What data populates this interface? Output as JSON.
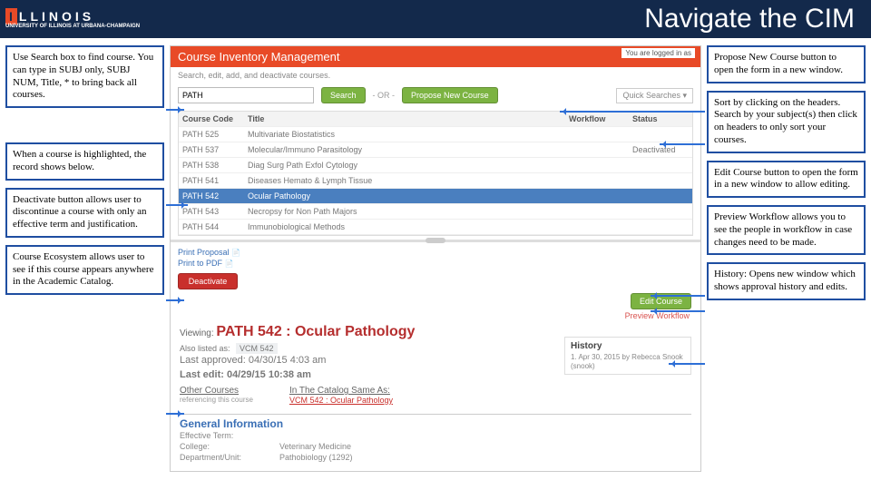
{
  "header": {
    "logo_letter": "I",
    "logo_rest": "LLINOIS",
    "logo_sub": "UNIVERSITY OF ILLINOIS AT URBANA-CHAMPAIGN",
    "title": "Navigate the CIM"
  },
  "left": {
    "c1": "Use Search box to find course. You can type in SUBJ only, SUBJ NUM, Title, * to bring back all courses.",
    "c2": "When a course is highlighted, the record shows below.",
    "c3": "Deactivate button allows user to discontinue a course with only an effective term and justification.",
    "c4": "Course Ecosystem allows user to see if this course appears anywhere in the Academic Catalog."
  },
  "right": {
    "c1": "Propose New Course button to open the form in a new window.",
    "c2": "Sort by clicking on the headers. Search by your subject(s) then click on headers to only sort your courses.",
    "c3": "Edit Course button to open the form in a new window to allow editing.",
    "c4": "Preview Workflow allows you to see the people in workflow in case changes need to be made.",
    "c5": "History: Opens new window which shows approval history and edits."
  },
  "app": {
    "title": "Course Inventory Management",
    "login": "You are logged in as",
    "subtitle": "Search, edit, add, and deactivate courses.",
    "search_placeholder": "PATH",
    "btn_search": "Search",
    "or": "- OR -",
    "btn_propose": "Propose New Course",
    "quick": "Quick Searches ▾",
    "cols": {
      "code": "Course Code",
      "title": "Title",
      "workflow": "Workflow",
      "status": "Status"
    },
    "rows": [
      {
        "code": "PATH 525",
        "title": "Multivariate Biostatistics",
        "wf": "",
        "st": ""
      },
      {
        "code": "PATH 537",
        "title": "Molecular/Immuno Parasitology",
        "wf": "",
        "st": "Deactivated"
      },
      {
        "code": "PATH 538",
        "title": "Diag Surg Path Exfol Cytology",
        "wf": "",
        "st": ""
      },
      {
        "code": "PATH 541",
        "title": "Diseases Hemato & Lymph Tissue",
        "wf": "",
        "st": ""
      },
      {
        "code": "PATH 542",
        "title": "Ocular Pathology",
        "wf": "",
        "st": "",
        "sel": true
      },
      {
        "code": "PATH 543",
        "title": "Necropsy for Non Path Majors",
        "wf": "",
        "st": ""
      },
      {
        "code": "PATH 544",
        "title": "Immunobiological Methods",
        "wf": "",
        "st": ""
      }
    ],
    "print_proposal": "Print Proposal",
    "print_pdf": "Print to PDF",
    "btn_deactivate": "Deactivate",
    "btn_edit": "Edit Course",
    "preview_wf": "Preview Workflow",
    "viewing_label": "Viewing:",
    "viewing_course": "PATH 542 : Ocular Pathology",
    "also_label": "Also listed as:",
    "also_val": "VCM 542",
    "approved": "Last approved: 04/30/15 4:03 am",
    "edited": "Last edit: 04/29/15 10:38 am",
    "history_title": "History",
    "history_item": "1. Apr 30, 2015 by Rebecca Snook (snook)",
    "other_h": "Other Courses",
    "other_s": "referencing this course",
    "catalog_h": "In The Catalog Same As:",
    "catalog_link": "VCM 542 : Ocular Pathology",
    "gen_title": "General Information",
    "eff": "Effective Term:",
    "college_l": "College:",
    "college_v": "Veterinary Medicine",
    "dept_l": "Department/Unit:",
    "dept_v": "Pathobiology (1292)"
  }
}
